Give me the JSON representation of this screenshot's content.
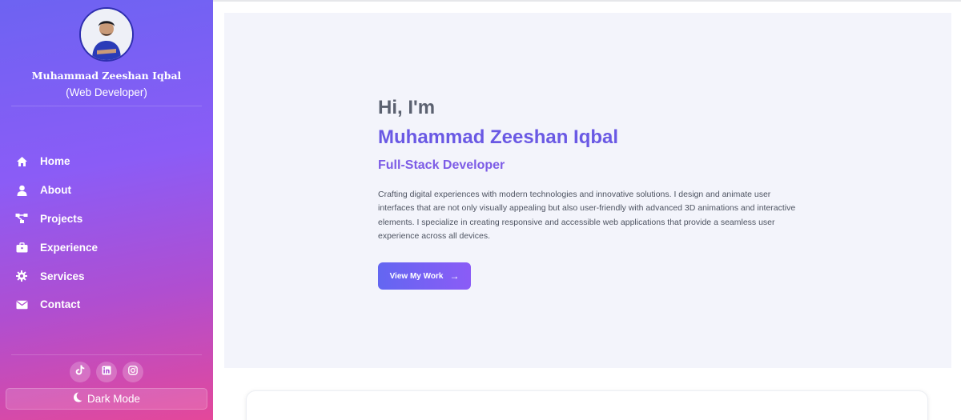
{
  "profile": {
    "name": "Muhammad Zeeshan Iqbal",
    "role": "(Web Developer)",
    "avatar_icon": "user-avatar"
  },
  "nav": {
    "items": [
      {
        "label": "Home",
        "icon": "home-icon"
      },
      {
        "label": "About",
        "icon": "user-icon"
      },
      {
        "label": "Projects",
        "icon": "project-diagram-icon"
      },
      {
        "label": "Experience",
        "icon": "briefcase-icon"
      },
      {
        "label": "Services",
        "icon": "gear-icon"
      },
      {
        "label": "Contact",
        "icon": "envelope-icon"
      }
    ]
  },
  "socials": [
    {
      "icon": "tiktok-icon"
    },
    {
      "icon": "linkedin-icon"
    },
    {
      "icon": "instagram-icon"
    }
  ],
  "theme_toggle": {
    "label": "Dark Mode",
    "icon": "moon-icon"
  },
  "hero": {
    "greeting": "Hi, I'm",
    "name": "Muhammad Zeeshan Iqbal",
    "role": "Full-Stack Developer",
    "description": "Crafting digital experiences with modern technologies and innovative solutions. I design and animate user interfaces that are not only visually appealing but also user-friendly with advanced 3D animations and interactive elements. I specialize in creating responsive and accessible web applications that provide a seamless user experience across all devices.",
    "cta_label": "View My Work",
    "cta_arrow": "→"
  },
  "colors": {
    "accent": "#6a59e4",
    "sidebar_top": "#6d63f2",
    "sidebar_bottom": "#e4489a"
  }
}
